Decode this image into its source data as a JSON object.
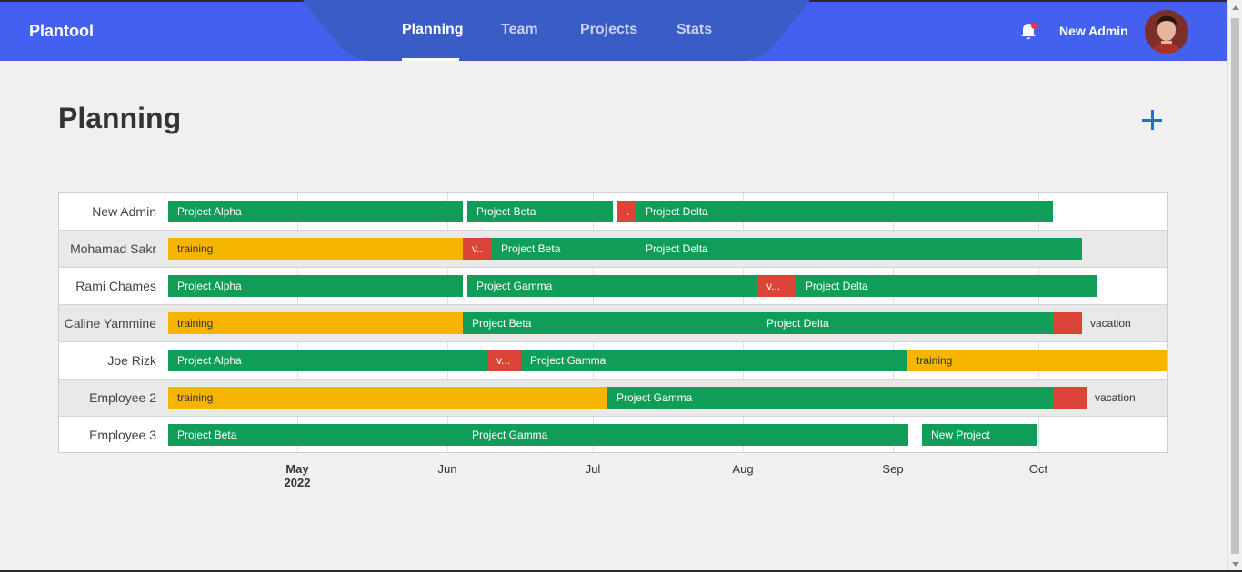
{
  "app": {
    "brand": "Plantool",
    "user_name": "New Admin"
  },
  "nav": {
    "tabs": [
      "Planning",
      "Team",
      "Projects",
      "Stats"
    ],
    "active": "Planning"
  },
  "page": {
    "title": "Planning",
    "add_label": "+"
  },
  "colors": {
    "header": "#4361ee",
    "project": "#0f9d58",
    "training": "#f4b400",
    "vacation": "#db4437",
    "accent": "#1e6fd9"
  },
  "timeline": {
    "axis": [
      {
        "month": "May",
        "year": "2022"
      },
      {
        "month": "Jun"
      },
      {
        "month": "Jul"
      },
      {
        "month": "Aug"
      },
      {
        "month": "Sep"
      },
      {
        "month": "Oct"
      }
    ],
    "rows": [
      {
        "name": "New Admin",
        "items": [
          {
            "label": "Project Alpha",
            "type": "project"
          },
          {
            "label": "Project Beta",
            "type": "project"
          },
          {
            "label": ".",
            "type": "vacation"
          },
          {
            "label": "Project Delta",
            "type": "project"
          }
        ]
      },
      {
        "name": "Mohamad Sakr",
        "items": [
          {
            "label": "training",
            "type": "training"
          },
          {
            "label": "v..",
            "type": "vacation"
          },
          {
            "label": "Project Beta",
            "type": "project"
          },
          {
            "label": "Project Delta",
            "type": "project"
          }
        ]
      },
      {
        "name": "Rami Chames",
        "items": [
          {
            "label": "Project Alpha",
            "type": "project"
          },
          {
            "label": "Project Gamma",
            "type": "project"
          },
          {
            "label": "v...",
            "type": "vacation"
          },
          {
            "label": "Project Delta",
            "type": "project"
          }
        ]
      },
      {
        "name": "Caline Yammine",
        "items": [
          {
            "label": "training",
            "type": "training"
          },
          {
            "label": "Project Beta",
            "type": "project"
          },
          {
            "label": "Project Delta",
            "type": "project"
          },
          {
            "label": "",
            "type": "vacation"
          }
        ],
        "trailing_label": "vacation"
      },
      {
        "name": "Joe Rizk",
        "items": [
          {
            "label": "Project Alpha",
            "type": "project"
          },
          {
            "label": "v...",
            "type": "vacation"
          },
          {
            "label": "Project Gamma",
            "type": "project"
          },
          {
            "label": "training",
            "type": "training"
          }
        ]
      },
      {
        "name": "Employee 2",
        "items": [
          {
            "label": "training",
            "type": "training"
          },
          {
            "label": "Project Gamma",
            "type": "project"
          },
          {
            "label": "",
            "type": "vacation"
          }
        ],
        "trailing_label": "vacation"
      },
      {
        "name": "Employee 3",
        "items": [
          {
            "label": "Project Beta",
            "type": "project"
          },
          {
            "label": "Project Gamma",
            "type": "project"
          },
          {
            "label": "New Project",
            "type": "project"
          }
        ]
      }
    ]
  }
}
